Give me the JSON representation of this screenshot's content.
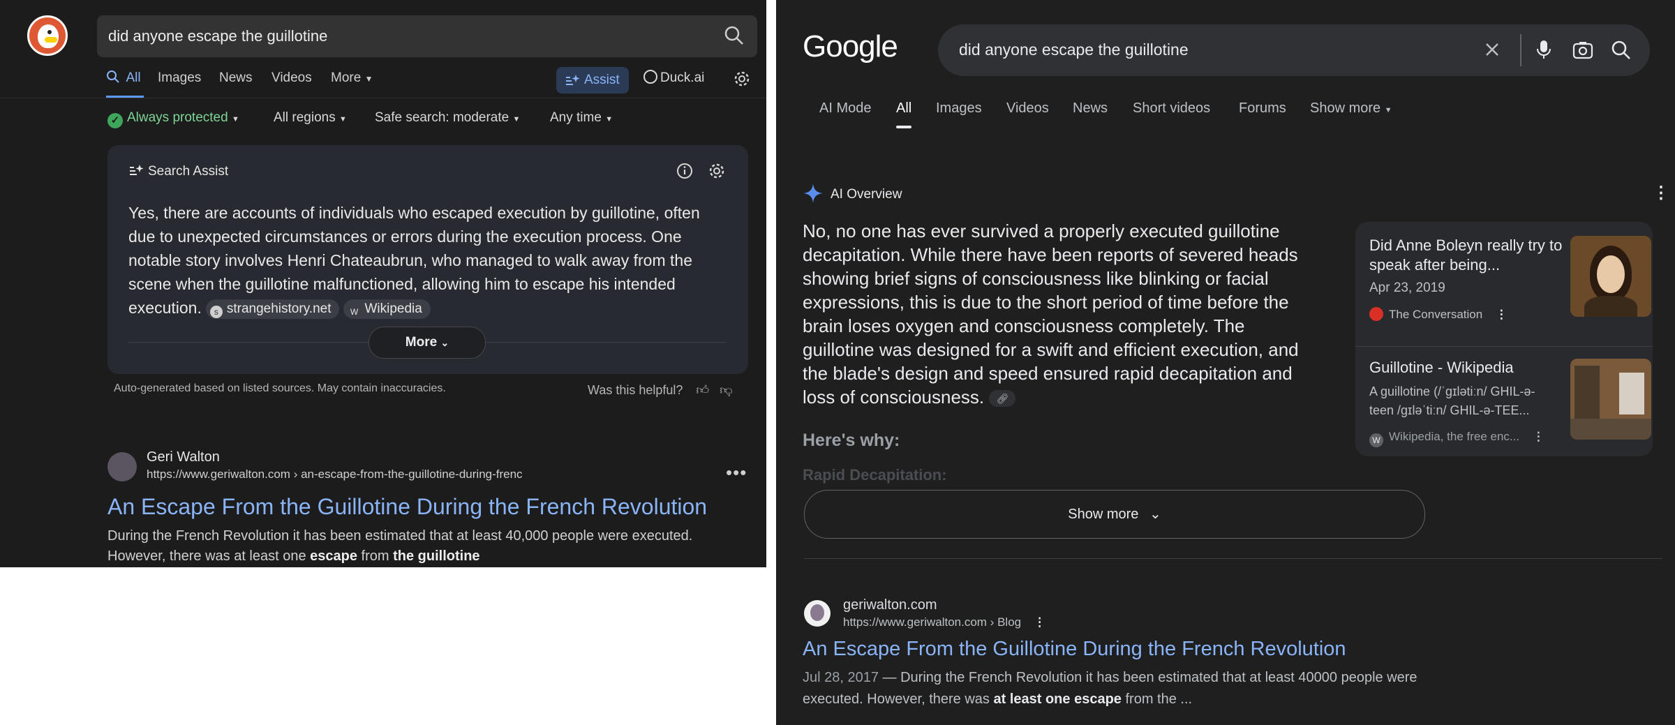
{
  "ddg": {
    "query": "did anyone escape the guillotine",
    "tabs": [
      "All",
      "Images",
      "News",
      "Videos",
      "More"
    ],
    "assist_label": "Assist",
    "duckai_label": "Duck.ai",
    "filters": [
      "Always protected",
      "All regions",
      "Safe search: moderate",
      "Any time"
    ],
    "assist_card": {
      "title": "Search Assist",
      "answer": "Yes, there are accounts of individuals who escaped execution by guillotine, often due to unexpected circumstances or errors during the execution process. One notable story involves Henri Chateaubrun, who managed to walk away from the scene when the guillotine malfunctioned, allowing him to escape his intended execution.",
      "sources": [
        "strangehistory.net",
        "Wikipedia"
      ],
      "more_label": "More"
    },
    "disclaimer": "Auto-generated based on listed sources. May contain inaccuracies.",
    "helpful": "Was this helpful?",
    "result": {
      "site": "Geri Walton",
      "url": "https://www.geriwalton.com › an-escape-from-the-guillotine-during-frenc",
      "title": "An Escape From the Guillotine During the French Revolution",
      "snippet_1": "During the French Revolution it has been estimated that at least 40,000 people were executed.",
      "snippet_2a": "However, there was at least one ",
      "snippet_2b": "escape",
      "snippet_2c": " from ",
      "snippet_2d": "the guillotine"
    }
  },
  "google": {
    "logo": "Google",
    "query": "did anyone escape the guillotine",
    "tabs": [
      "AI Mode",
      "All",
      "Images",
      "Videos",
      "News",
      "Short videos",
      "Forums",
      "Show more"
    ],
    "ai_header": "AI Overview",
    "ai_text": "No, no one has ever survived a properly executed guillotine decapitation. While there have been reports of severed heads showing brief signs of consciousness like blinking or facial expressions, this is due to the short period of time before the brain loses oxygen and consciousness completely. The guillotine was designed for a swift and efficient execution, and the blade's design and speed ensured rapid decapitation and loss of consciousness.",
    "heres_why": "Here's why:",
    "rapid": "Rapid Decapitation:",
    "show_more": "Show more",
    "side": [
      {
        "title": "Did Anne Boleyn really try to speak after being...",
        "date": "Apr 23, 2019",
        "source": "The Conversation"
      },
      {
        "title": "Guillotine - Wikipedia",
        "snippet": "A guillotine (/ˈɡɪlətiːn/ GHIL-ə-teen /ɡɪləˈtiːn/ GHIL-ə-TEE...",
        "source": "Wikipedia, the free enc..."
      }
    ],
    "result": {
      "site": "geriwalton.com",
      "url": "https://www.geriwalton.com › Blog",
      "title": "An Escape From the Guillotine During the French Revolution",
      "date": "Jul 28, 2017",
      "snippet_1": " — During the French Revolution it has been estimated that at least 40000 people were",
      "snippet_2a": "executed. However, there was ",
      "snippet_2b": "at least one escape",
      "snippet_2c": " from the ..."
    }
  }
}
